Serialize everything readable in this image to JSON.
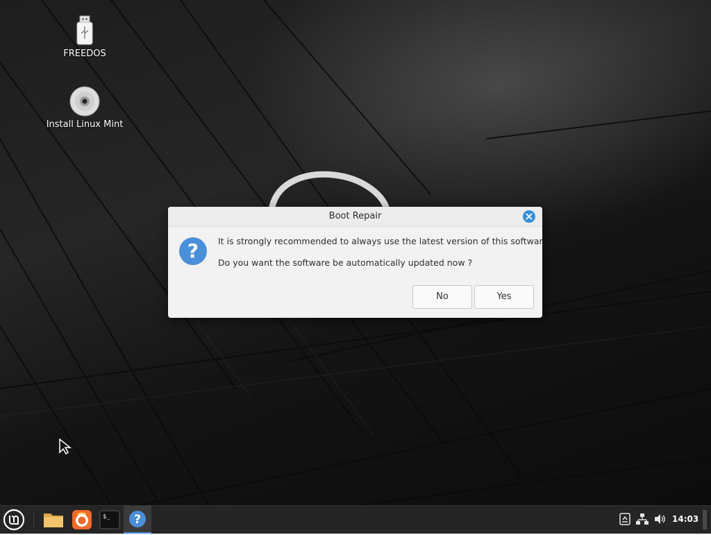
{
  "desktop": {
    "icons": [
      {
        "label": "FREEDOS",
        "icon": "usb-drive-icon"
      },
      {
        "label": "Install Linux Mint",
        "icon": "cd-disc-icon"
      }
    ]
  },
  "dialog": {
    "title": "Boot Repair",
    "message_line1": "It is strongly recommended to always use the latest version of this software.",
    "message_line2": "Do you want the software be automatically updated now ?",
    "icon": "question-icon",
    "buttons": {
      "no_label": "No",
      "yes_label": "Yes"
    },
    "accent_color": "#3a8fd6"
  },
  "taskbar": {
    "apps": [
      {
        "name": "menu",
        "icon": "linux-mint-menu-icon"
      },
      {
        "name": "files",
        "icon": "folder-icon"
      },
      {
        "name": "firefox",
        "icon": "firefox-icon"
      },
      {
        "name": "terminal",
        "icon": "terminal-icon"
      },
      {
        "name": "boot-repair",
        "icon": "question-icon",
        "active": true
      }
    ],
    "tray": [
      "updates-icon",
      "network-icon",
      "volume-icon"
    ],
    "clock": "14:03"
  }
}
